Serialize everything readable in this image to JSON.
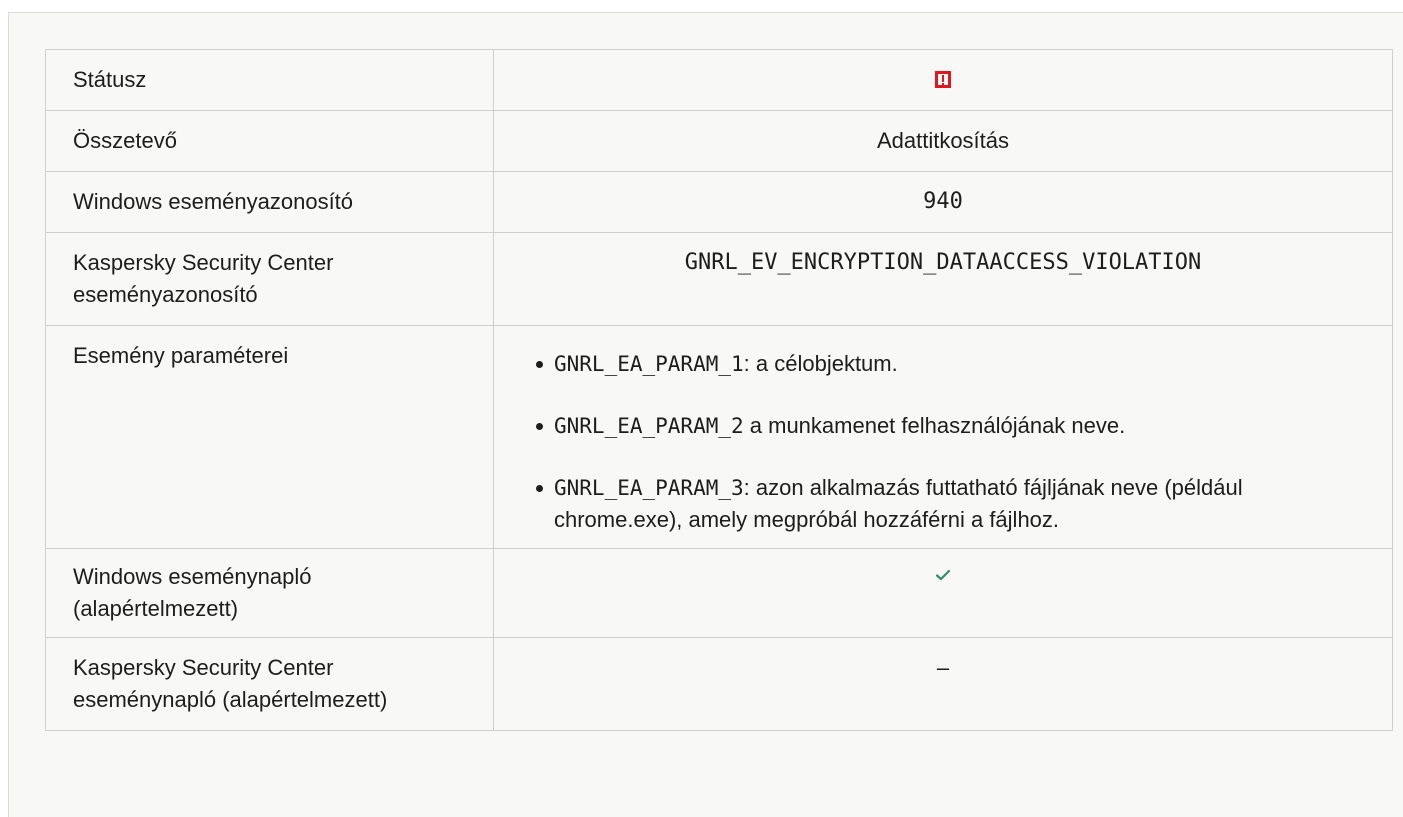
{
  "rows": {
    "status": {
      "label": "Státusz",
      "icon": "warning-icon",
      "icon_color": "#e0171f"
    },
    "component": {
      "label": "Összetevő",
      "value": "Adattitkosítás"
    },
    "windows_event_id": {
      "label": "Windows eseményazonosító",
      "value": "940"
    },
    "ksc_event_id": {
      "label": "Kaspersky Security Center eseményazonosító",
      "value": "GNRL_EV_ENCRYPTION_DATAACCESS_VIOLATION"
    },
    "event_params": {
      "label": "Esemény paraméterei",
      "items": [
        {
          "code": "GNRL_EA_PARAM_1",
          "text": ": a célobjektum."
        },
        {
          "code": "GNRL_EA_PARAM_2",
          "text": " a munkamenet felhasználójának neve."
        },
        {
          "code": "GNRL_EA_PARAM_3",
          "text": ": azon alkalmazás futtatható fájljának neve (például chrome.exe), amely megpróbál hozzáférni a fájlhoz."
        }
      ]
    },
    "windows_log": {
      "label": "Windows eseménynapló (alapértelmezett)",
      "icon": "check-icon",
      "icon_color": "#2f8f6b"
    },
    "ksc_log": {
      "label": "Kaspersky Security Center eseménynapló (alapértelmezett)",
      "value": "–"
    }
  }
}
